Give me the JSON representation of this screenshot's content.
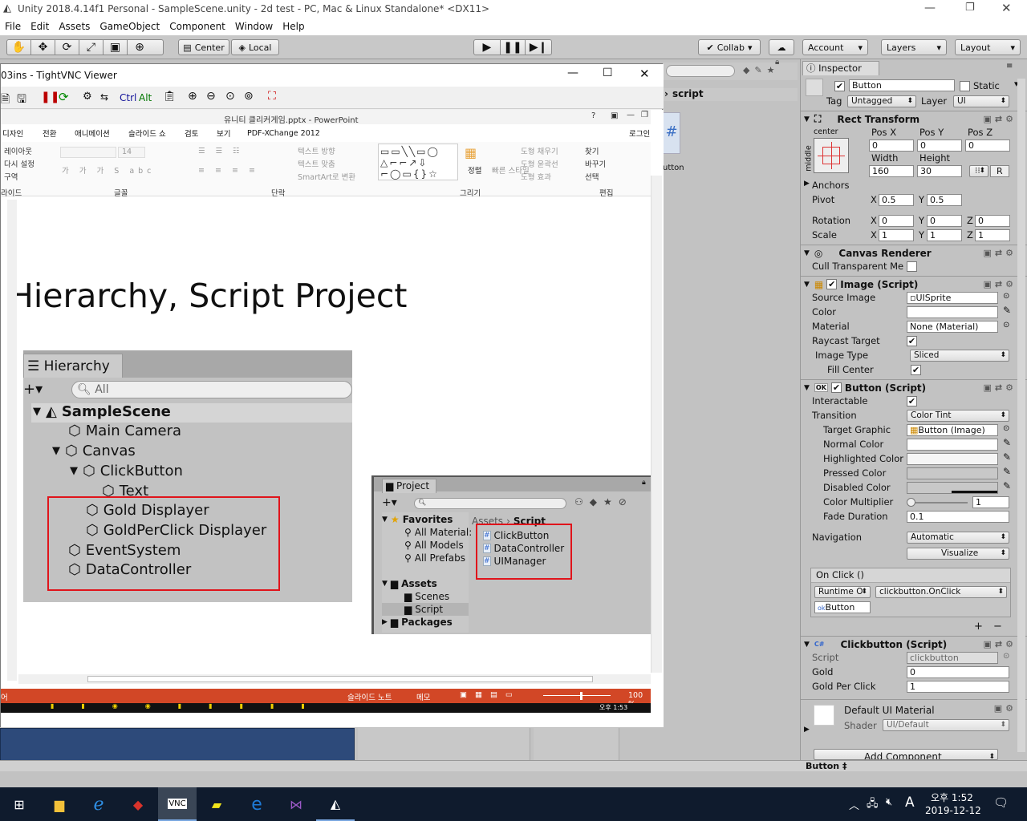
{
  "window": {
    "title": "Unity 2018.4.14f1 Personal - SampleScene.unity - 2d test - PC, Mac & Linux Standalone* <DX11>"
  },
  "menu": [
    "File",
    "Edit",
    "Assets",
    "GameObject",
    "Component",
    "Window",
    "Help"
  ],
  "toolbar": {
    "center_label": "Center",
    "local_label": "Local",
    "collab_label": "Collab",
    "account_label": "Account",
    "layers_label": "Layers",
    "layout_label": "Layout"
  },
  "search_label": "script",
  "project_panel": {
    "partial_label": "utton"
  },
  "inspector": {
    "tab": "Inspector",
    "object_name": "Button",
    "static_label": "Static",
    "tag_label": "Tag",
    "tag_value": "Untagged",
    "layer_label": "Layer",
    "layer_value": "UI",
    "rect_transform": {
      "title": "Rect Transform",
      "anchor_h": "center",
      "anchor_v": "middle",
      "posx_label": "Pos X",
      "posy_label": "Pos Y",
      "posz_label": "Pos Z",
      "posx": "0",
      "posy": "0",
      "posz": "0",
      "width_label": "Width",
      "height_label": "Height",
      "width": "160",
      "height": "30",
      "r_label": "R",
      "anchors_label": "Anchors",
      "pivot_label": "Pivot",
      "pivot_x": "0.5",
      "pivot_y": "0.5",
      "rotation_label": "Rotation",
      "rot_x": "0",
      "rot_y": "0",
      "rot_z": "0",
      "scale_label": "Scale",
      "scale_x": "1",
      "scale_y": "1",
      "scale_z": "1",
      "x": "X",
      "y": "Y",
      "z": "Z"
    },
    "canvas_renderer": {
      "title": "Canvas Renderer",
      "cull_label": "Cull Transparent Me"
    },
    "image": {
      "title": "Image (Script)",
      "source_label": "Source Image",
      "source_value": "UISprite",
      "color_label": "Color",
      "material_label": "Material",
      "material_value": "None (Material)",
      "raycast_label": "Raycast Target",
      "type_label": "Image Type",
      "type_value": "Sliced",
      "fill_label": "Fill Center"
    },
    "button": {
      "title": "Button (Script)",
      "interactable_label": "Interactable",
      "transition_label": "Transition",
      "transition_value": "Color Tint",
      "target_label": "Target Graphic",
      "target_value": "Button (Image)",
      "normal_label": "Normal Color",
      "highlighted_label": "Highlighted Color",
      "pressed_label": "Pressed Color",
      "disabled_label": "Disabled Color",
      "multiplier_label": "Color Multiplier",
      "multiplier_value": "1",
      "fade_label": "Fade Duration",
      "fade_value": "0.1",
      "navigation_label": "Navigation",
      "navigation_value": "Automatic",
      "visualize_label": "Visualize",
      "onclick_label": "On Click ()",
      "runtime_value": "Runtime O",
      "function_value": "clickbutton.OnClick",
      "object_value": "Button",
      "plus": "+",
      "minus": "−"
    },
    "clickbutton": {
      "title": "Clickbutton (Script)",
      "script_label": "Script",
      "script_value": "clickbutton",
      "gold_label": "Gold",
      "gold_value": "0",
      "gpc_label": "Gold Per Click",
      "gpc_value": "1"
    },
    "material": {
      "title": "Default UI Material",
      "shader_label": "Shader",
      "shader_value": "UI/Default"
    },
    "add_component": "Add Component"
  },
  "statusbar": {
    "text": "Button ‡"
  },
  "vnc": {
    "title": "03ins - TightVNC Viewer",
    "ctrl": "Ctrl",
    "alt": "Alt",
    "ppt_title": "유니티 클리커게임.pptx - PowerPoint",
    "tabs": [
      "디자인",
      "전환",
      "애니메이션",
      "슬라이드 쇼",
      "검토",
      "보기",
      "PDF-XChange 2012"
    ],
    "login": "로그인",
    "ribbon": {
      "layout": "레이아웃",
      "reset": "다시 설정",
      "section": "구역",
      "font_size": "14",
      "text_dir": "텍스트 방향",
      "text_align": "텍스트 맞춤",
      "smartart": "SmartArt로 변환",
      "arrange": "정렬",
      "quick": "빠른 스타일",
      "fill": "도형 채우기",
      "outline": "도형 윤곽선",
      "effect": "도형 효과",
      "find": "찾기",
      "replace": "바꾸기",
      "select": "선택",
      "grp_slide": "라이드",
      "grp_font": "글꼴",
      "grp_para": "단락",
      "grp_draw": "그리기",
      "grp_edit": "편집"
    },
    "slide_title": "Hierarchy, Script Project",
    "hierarchy": {
      "tab": "Hierarchy",
      "search": "All",
      "scene": "SampleScene",
      "items": [
        "Main Camera",
        "Canvas",
        "ClickButton",
        "Text",
        "Gold Displayer",
        "GoldPerClick Displayer",
        "EventSystem",
        "DataController"
      ]
    },
    "project": {
      "tab": "Project",
      "favorites": "Favorites",
      "fav_items": [
        "All Material:",
        "All Models",
        "All Prefabs"
      ],
      "assets": "Assets",
      "asset_items": [
        "Scenes",
        "Script"
      ],
      "packages": "Packages",
      "breadcrumb_assets": "Assets",
      "breadcrumb_sep": "›",
      "breadcrumb_script": "Script",
      "files": [
        "ClickButton",
        "DataController",
        "UIManager"
      ]
    },
    "ppt_status": {
      "notes": "슬라이드 노트",
      "memo": "메모",
      "zoom": "100 %",
      "left": "어"
    },
    "inner_clock": "오후 1:53"
  },
  "clock": {
    "time": "오후 1:52",
    "date": "2019-12-12"
  },
  "lang": "A",
  "colors": {
    "highlight_red": "#e0141b",
    "ppt_status": "#d24726",
    "vs_purple": "#68217a",
    "edge_blue": "#1e7ad6"
  }
}
